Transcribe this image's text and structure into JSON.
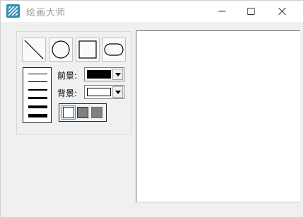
{
  "window": {
    "title": "绘画大师",
    "icon": "app-logo-icon",
    "controls": [
      "minimize-icon",
      "maximize-icon",
      "close-icon"
    ]
  },
  "tools": {
    "shapes": [
      "line",
      "circle",
      "rectangle",
      "rounded-rectangle"
    ],
    "line_widths": [
      "thin",
      "light",
      "medium",
      "bold",
      "heavy",
      "extra-heavy"
    ],
    "foreground": {
      "label": "前景:",
      "color": "#000000"
    },
    "background": {
      "label": "背景:",
      "color": "#ffffff"
    },
    "fill_modes": [
      "no-fill",
      "fill-gray",
      "fill-gray-alt"
    ]
  },
  "colors": {
    "accent": "#2f8fb0",
    "title_text": "#9a9a9a",
    "window_bg": "#f0f0f0"
  }
}
